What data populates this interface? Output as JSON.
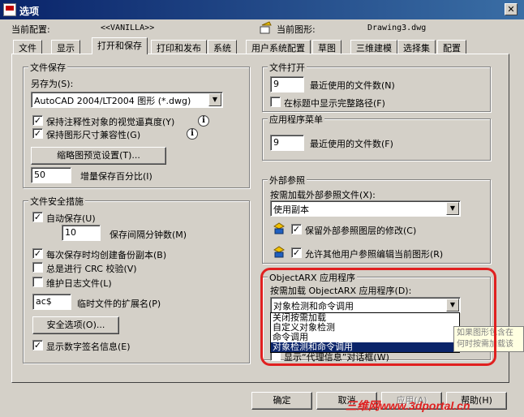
{
  "window": {
    "title": "选项",
    "close_glyph": "✕"
  },
  "header": {
    "profile_label": "当前配置:",
    "profile_value": "<<VANILLA>>",
    "drawing_label": "当前图形:",
    "drawing_value": "Drawing3.dwg"
  },
  "tabs": [
    "文件",
    "显示",
    "打开和保存",
    "打印和发布",
    "系统",
    "用户系统配置",
    "草图",
    "三维建模",
    "选择集",
    "配置"
  ],
  "active_tab": "打开和保存",
  "file_save": {
    "title": "文件保存",
    "save_as_label": "另存为(S):",
    "save_as_value": "AutoCAD 2004/LT2004 图形 (*.dwg)",
    "check_visual_fidelity": "保持注释性对象的视觉逼真度(Y)",
    "check_drawing_size": "保持图形尺寸兼容性(G)",
    "thumbnail_button": "缩略图预览设置(T)...",
    "incremental_value": "50",
    "incremental_label": "增量保存百分比(I)"
  },
  "file_safety": {
    "title": "文件安全措施",
    "autosave_label": "自动保存(U)",
    "autosave_minutes_value": "10",
    "autosave_minutes_label": "保存间隔分钟数(M)",
    "backup_label": "每次保存时均创建备份副本(B)",
    "crc_label": "总是进行 CRC 校验(V)",
    "log_label": "维护日志文件(L)",
    "temp_ext_value": "ac$",
    "temp_ext_label": "临时文件的扩展名(P)",
    "security_button": "安全选项(O)...",
    "digital_sig_label": "显示数字签名信息(E)"
  },
  "file_open": {
    "title": "文件打开",
    "recent_value": "9",
    "recent_label": "最近使用的文件数(N)",
    "full_path_label": "在标题中显示完整路径(F)"
  },
  "app_menu": {
    "title": "应用程序菜单",
    "recent_value": "9",
    "recent_label": "最近使用的文件数(F)"
  },
  "xref": {
    "title": "外部参照",
    "demand_load_label": "按需加载外部参照文件(X):",
    "demand_load_value": "使用副本",
    "retain_changes_label": "保留外部参照图层的修改(C)",
    "allow_edit_label": "允许其他用户参照编辑当前图形(R)"
  },
  "objectarx": {
    "title": "ObjectARX 应用程序",
    "demand_load_label": "按需加载 ObjectARX 应用程序(D):",
    "demand_load_value": "对象检测和命令调用",
    "options": [
      "关闭按需加载",
      "自定义对象检测",
      "命令调用",
      "对象检测和命令调用"
    ],
    "selected_index": 3,
    "proxy_label": "显示“代理信息”对话框(W)"
  },
  "tooltip": {
    "line1": "如果图形包含在",
    "line2": "何时按需加载该"
  },
  "footer": {
    "ok": "确定",
    "cancel": "取消",
    "apply": "应用(A)",
    "help": "帮助(H)"
  },
  "watermark": "三维网www.3dportal.cn",
  "colors": {
    "title_bar": "#0a246a",
    "dialog_bg": "#d4d0c8",
    "highlight": "#e02020",
    "selection": "#0a246a",
    "tooltip_bg": "#ffffe1"
  }
}
